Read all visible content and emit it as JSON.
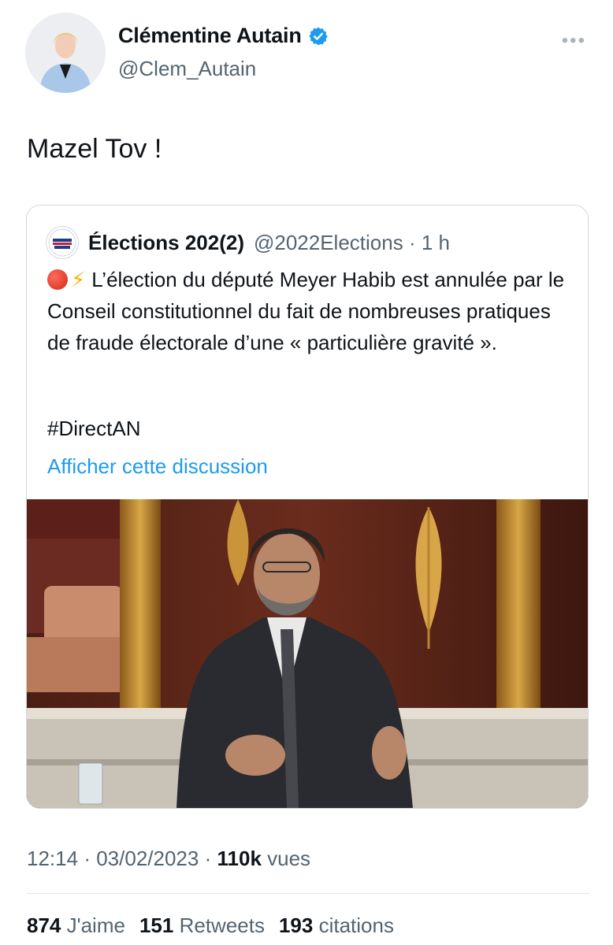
{
  "author": {
    "name": "Clémentine Autain",
    "handle": "@Clem_Autain",
    "verified_color": "#1d9bf0"
  },
  "tweet": {
    "text": "Mazel Tov !"
  },
  "quote": {
    "name": "Élections 202(2)",
    "handle": "@2022Elections",
    "separator": "·",
    "time": "1 h",
    "emoji": [
      "red-circle",
      "high-voltage"
    ],
    "text": "L’élection du député Meyer Habib est annulée par le Conseil constitutionnel du fait de nombreuses pratiques de fraude électorale d’une « particulière gravité ».",
    "hashtag": "#DirectAN",
    "show_thread": "Afficher cette discussion",
    "link_color": "#1d9bf0"
  },
  "meta": {
    "time": "12:14",
    "separator": "·",
    "date": "03/02/2023",
    "views_count": "110k",
    "views_label": "vues"
  },
  "stats": {
    "likes_count": "874",
    "likes_label": "J'aime",
    "retweets_count": "151",
    "retweets_label": "Retweets",
    "quotes_count": "193",
    "quotes_label": "citations"
  }
}
